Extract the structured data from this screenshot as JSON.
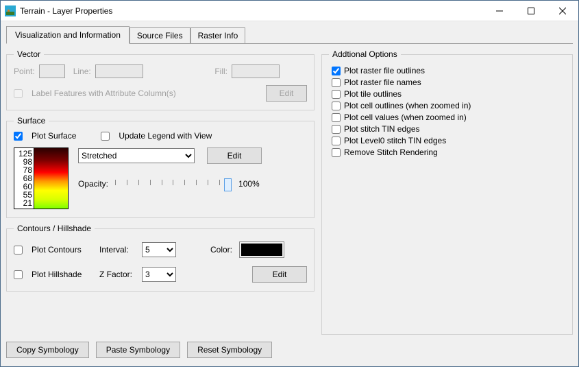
{
  "window": {
    "title": "Terrain - Layer Properties"
  },
  "tabs": [
    {
      "label": "Visualization and Information",
      "active": true
    },
    {
      "label": "Source Files",
      "active": false
    },
    {
      "label": "Raster Info",
      "active": false
    }
  ],
  "vector": {
    "legend": "Vector",
    "point_label": "Point:",
    "line_label": "Line:",
    "fill_label": "Fill:",
    "label_features_label": "Label Features with Attribute Column(s)",
    "label_features_checked": false,
    "edit_label": "Edit"
  },
  "surface": {
    "legend": "Surface",
    "plot_surface_label": "Plot Surface",
    "plot_surface_checked": true,
    "update_legend_label": "Update Legend with View",
    "update_legend_checked": false,
    "stretch_mode": "Stretched",
    "edit_label": "Edit",
    "opacity_label": "Opacity:",
    "opacity_value": "100%",
    "gradient_ticks": [
      "125",
      "98",
      "78",
      "68",
      "60",
      "55",
      "21"
    ]
  },
  "contours": {
    "legend": "Contours / Hillshade",
    "plot_contours_label": "Plot Contours",
    "plot_contours_checked": false,
    "interval_label": "Interval:",
    "interval_value": "5",
    "color_label": "Color:",
    "color_value": "#000000",
    "plot_hillshade_label": "Plot Hillshade",
    "plot_hillshade_checked": false,
    "zfactor_label": "Z Factor:",
    "zfactor_value": "3",
    "edit_label": "Edit"
  },
  "additional": {
    "legend": "Addtional Options",
    "items": [
      {
        "label": "Plot raster file outlines",
        "checked": true
      },
      {
        "label": "Plot raster file names",
        "checked": false
      },
      {
        "label": "Plot tile outlines",
        "checked": false
      },
      {
        "label": "Plot cell outlines (when zoomed in)",
        "checked": false
      },
      {
        "label": "Plot cell values (when zoomed in)",
        "checked": false
      },
      {
        "label": "Plot stitch TIN edges",
        "checked": false
      },
      {
        "label": "Plot Level0 stitch TIN edges",
        "checked": false
      },
      {
        "label": "Remove Stitch Rendering",
        "checked": false
      }
    ]
  },
  "buttons": {
    "copy": "Copy Symbology",
    "paste": "Paste Symbology",
    "reset": "Reset Symbology"
  }
}
